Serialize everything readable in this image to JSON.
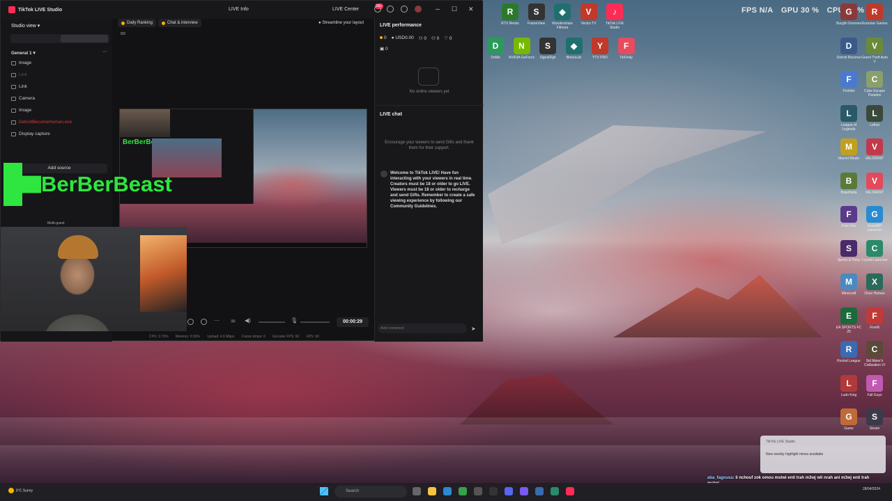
{
  "app": {
    "title": "TikTok LIVE Studio",
    "live_info": "LIVE Info",
    "live_center": "LIVE Center",
    "notif_badge": "99+",
    "minimize": "─",
    "maximize": "☐",
    "close": "✕"
  },
  "sidebar": {
    "studio_view": "Studio view",
    "group": "General 1",
    "sources": [
      {
        "label": "Image",
        "state": "normal"
      },
      {
        "label": "Link",
        "state": "dim"
      },
      {
        "label": "Link",
        "state": "normal"
      },
      {
        "label": "Camera",
        "state": "normal"
      },
      {
        "label": "Image",
        "state": "normal"
      },
      {
        "label": "DetroitBecomeHuman.exe",
        "state": "error"
      },
      {
        "label": "Display capture",
        "state": "normal"
      }
    ],
    "add_source": "Add source",
    "watermark": "BerBerBeast",
    "multi_guest": "Multi-guest"
  },
  "center": {
    "tabs": [
      {
        "label": "Daily Ranking"
      },
      {
        "label": "Chat & interview"
      }
    ],
    "streamline": "Streamline your layout",
    "rank_progress": "0/3",
    "timer": "00:00:29"
  },
  "stats": {
    "cpu": "CPU: 2.76%",
    "memory": "Memory: 0.56%",
    "upload": "Upload: 4.6 Mbps",
    "frame_drops": "Frame drops: 0",
    "encoder_fps": "Encoder FPS: 60",
    "fps": "FPS: 60"
  },
  "right_panel": {
    "performance_title": "LIVE performance",
    "coins": "0",
    "usd": "USD0.00",
    "viewers": "0",
    "new_followers": "0",
    "likes": "0",
    "gifters": "0",
    "no_viewers": "No online viewers yet",
    "chat_title": "LIVE chat",
    "encourage": "Encourage your viewers to send Gifts and thank them for their support.",
    "welcome": "Welcome to TikTok LIVE! Have fun interacting with your viewers in real time. Creators must be 18 or older to go LIVE. Viewers must be 18 or older to recharge and send Gifts. Remember to create a safe viewing experience by following our Community Guidelines.",
    "comment_placeholder": "Add comment"
  },
  "hud": {
    "fps": "FPS N/A",
    "gpu": "GPU 30 %",
    "cpu": "CPU 26 %"
  },
  "desktop_icons": {
    "top_row": [
      {
        "label": "RTX Remix",
        "glyph": "R",
        "color": "#2a7a2a"
      },
      {
        "label": "FrameView",
        "glyph": "S",
        "color": "#333"
      },
      {
        "label": "Wondershare Filmora",
        "glyph": "◆",
        "color": "#1f6f6f"
      },
      {
        "label": "Vectra TV",
        "glyph": "V",
        "color": "#c0392b"
      },
      {
        "label": "TikTok LIVE Studio",
        "glyph": "♪",
        "color": "#fe2c55"
      }
    ],
    "second_row": [
      {
        "label": "DoMe",
        "glyph": "D",
        "color": "#2a9a5a"
      },
      {
        "label": "NVIDIA GeForce",
        "glyph": "N",
        "color": "#76b900"
      },
      {
        "label": "SignalRgb",
        "glyph": "S",
        "color": "#333"
      },
      {
        "label": "filmora-dc",
        "glyph": "◆",
        "color": "#1f6f6f"
      },
      {
        "label": "YTV PRO",
        "glyph": "Y",
        "color": "#c0392b"
      },
      {
        "label": "TikFinity",
        "glyph": "F",
        "color": "#e74c5e"
      }
    ],
    "right_col1": [
      {
        "label": "Burglin Gnomes",
        "glyph": "G",
        "color": "#8a3a3a"
      },
      {
        "label": "Detroit Become",
        "glyph": "D",
        "color": "#3a5a8a"
      },
      {
        "label": "Fortnite",
        "glyph": "F",
        "color": "#4a7ad0"
      },
      {
        "label": "League of Legends",
        "glyph": "L",
        "color": "#2a5a6a"
      },
      {
        "label": "Marvel Rivals",
        "glyph": "M",
        "color": "#c0a020"
      },
      {
        "label": "Brawlhalla",
        "glyph": "B",
        "color": "#5a7a3a"
      },
      {
        "label": "Free Fire",
        "glyph": "F",
        "color": "#5a3a8a"
      },
      {
        "label": "Sports & Party",
        "glyph": "S",
        "color": "#4a2a6a"
      },
      {
        "label": "Minecraft",
        "glyph": "M",
        "color": "#4a8ac0"
      },
      {
        "label": "EA SPORTS FC 25",
        "glyph": "E",
        "color": "#1a6a3a"
      },
      {
        "label": "Rocket League",
        "glyph": "R",
        "color": "#3a6ab0"
      },
      {
        "label": "Ludo King",
        "glyph": "L",
        "color": "#b03a3a"
      },
      {
        "label": "Game",
        "glyph": "G",
        "color": "#c06a3a"
      }
    ],
    "right_col2": [
      {
        "label": "Rockstar Games",
        "glyph": "R",
        "color": "#c0392b"
      },
      {
        "label": "Grand Theft Auto V",
        "glyph": "V",
        "color": "#6a8a3a"
      },
      {
        "label": "Cube Escape Paradox",
        "glyph": "C",
        "color": "#8aa06a"
      },
      {
        "label": "Lethal",
        "glyph": "L",
        "color": "#3a4a3a"
      },
      {
        "label": "VALORANT",
        "glyph": "V",
        "color": "#c03a4a"
      },
      {
        "label": "VALORANT",
        "glyph": "V",
        "color": "#e34a5a"
      },
      {
        "label": "GrandRP Launcher",
        "glyph": "G",
        "color": "#2a8ad0"
      },
      {
        "label": "Crystal Launcher",
        "glyph": "C",
        "color": "#2a8a6a"
      },
      {
        "label": "Once Human",
        "glyph": "X",
        "color": "#2a6a5a"
      },
      {
        "label": "FiveM",
        "glyph": "F",
        "color": "#c03a3a"
      },
      {
        "label": "Sid Meier's Civilization VI",
        "glyph": "C",
        "color": "#5a4a3a"
      },
      {
        "label": "Fall Guys",
        "glyph": "F",
        "color": "#c05ab0"
      },
      {
        "label": "Steam",
        "glyph": "S",
        "color": "#3a3a4a"
      }
    ]
  },
  "toast": {
    "title": "TikTok LIVE Studio",
    "body": "New weekly highlight mixes available"
  },
  "chat_overlay": {
    "user": "aba_fagousa",
    "message": ": li nchouf zok omou mstwi enti trah m3wj wli nrah ani m3wj enti trah mstwi"
  },
  "taskbar": {
    "weather_temp": "6°C",
    "weather_desc": "Sunny",
    "search": "Search",
    "clock_date": "28/04/2024"
  }
}
